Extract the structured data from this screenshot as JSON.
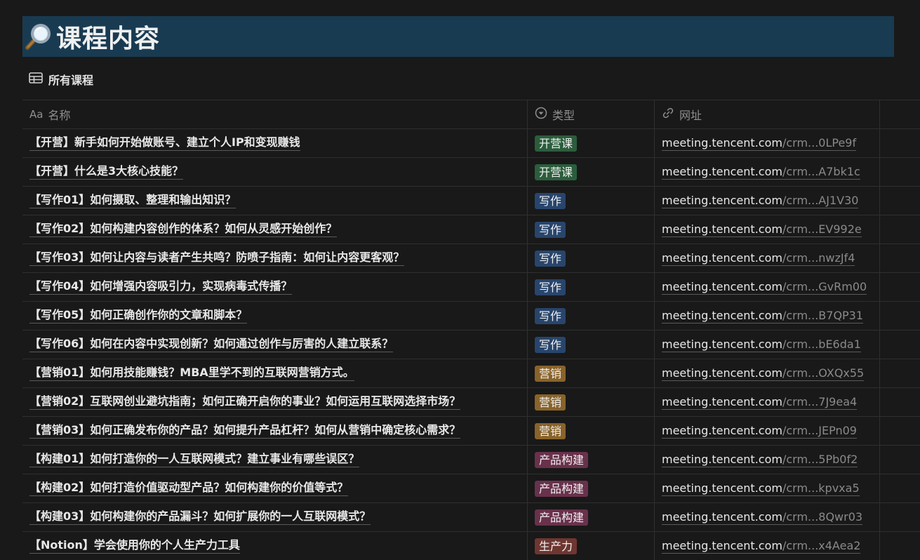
{
  "page": {
    "heading_icon": "magnifier-icon",
    "title": "课程内容"
  },
  "view": {
    "icon": "table-icon",
    "label": "所有课程"
  },
  "columns": {
    "name": {
      "icon": "text-property-icon",
      "icon_text": "Aa",
      "label": "名称"
    },
    "type": {
      "icon": "select-property-icon",
      "label": "类型"
    },
    "url": {
      "icon": "link-icon",
      "label": "网址"
    }
  },
  "tag_colors": {
    "开营课": "#2b5d3c",
    "写作": "#28456c",
    "营销": "#89632a",
    "产品构建": "#69314c",
    "生产力": "#6e3630"
  },
  "rows": [
    {
      "name": "【开营】新手如何开始做账号、建立个人IP和变现赚钱",
      "type": "开营课",
      "url_domain": "meeting.tencent.com",
      "url_path": "/crm...0LPe9f"
    },
    {
      "name": "【开营】什么是3大核心技能？",
      "type": "开营课",
      "url_domain": "meeting.tencent.com",
      "url_path": "/crm...A7bk1c"
    },
    {
      "name": "【写作01】如何摄取、整理和输出知识？",
      "type": "写作",
      "url_domain": "meeting.tencent.com",
      "url_path": "/crm...AJ1V30"
    },
    {
      "name": "【写作02】如何构建内容创作的体系？如何从灵感开始创作？",
      "type": "写作",
      "url_domain": "meeting.tencent.com",
      "url_path": "/crm...EV992e"
    },
    {
      "name": "【写作03】如何让内容与读者产生共鸣？防喷子指南：如何让内容更客观？",
      "type": "写作",
      "url_domain": "meeting.tencent.com",
      "url_path": "/crm...nwzJf4"
    },
    {
      "name": "【写作04】如何增强内容吸引力，实现病毒式传播？",
      "type": "写作",
      "url_domain": "meeting.tencent.com",
      "url_path": "/crm...GvRm00"
    },
    {
      "name": "【写作05】如何正确创作你的文章和脚本？",
      "type": "写作",
      "url_domain": "meeting.tencent.com",
      "url_path": "/crm...B7QP31"
    },
    {
      "name": "【写作06】如何在内容中实现创新？如何通过创作与厉害的人建立联系？",
      "type": "写作",
      "url_domain": "meeting.tencent.com",
      "url_path": "/crm...bE6da1"
    },
    {
      "name": "【营销01】如何用技能赚钱？MBA里学不到的互联网营销方式。",
      "type": "营销",
      "url_domain": "meeting.tencent.com",
      "url_path": "/crm...OXQx55"
    },
    {
      "name": "【营销02】互联网创业避坑指南；如何正确开启你的事业？如何运用互联网选择市场？",
      "type": "营销",
      "url_domain": "meeting.tencent.com",
      "url_path": "/crm...7J9ea4"
    },
    {
      "name": "【营销03】如何正确发布你的产品？如何提升产品杠杆？如何从营销中确定核心需求？",
      "type": "营销",
      "url_domain": "meeting.tencent.com",
      "url_path": "/crm...JEPn09"
    },
    {
      "name": "【构建01】如何打造你的一人互联网模式？建立事业有哪些误区？",
      "type": "产品构建",
      "url_domain": "meeting.tencent.com",
      "url_path": "/crm...5Pb0f2"
    },
    {
      "name": "【构建02】如何打造价值驱动型产品？如何构建你的价值等式？",
      "type": "产品构建",
      "url_domain": "meeting.tencent.com",
      "url_path": "/crm...kpvxa5"
    },
    {
      "name": "【构建03】如何构建你的产品漏斗？如何扩展你的一人互联网模式？",
      "type": "产品构建",
      "url_domain": "meeting.tencent.com",
      "url_path": "/crm...8Qwr03"
    },
    {
      "name": "【Notion】学会使用你的个人生产力工具",
      "type": "生产力",
      "url_domain": "meeting.tencent.com",
      "url_path": "/crm...x4Aea2"
    }
  ]
}
